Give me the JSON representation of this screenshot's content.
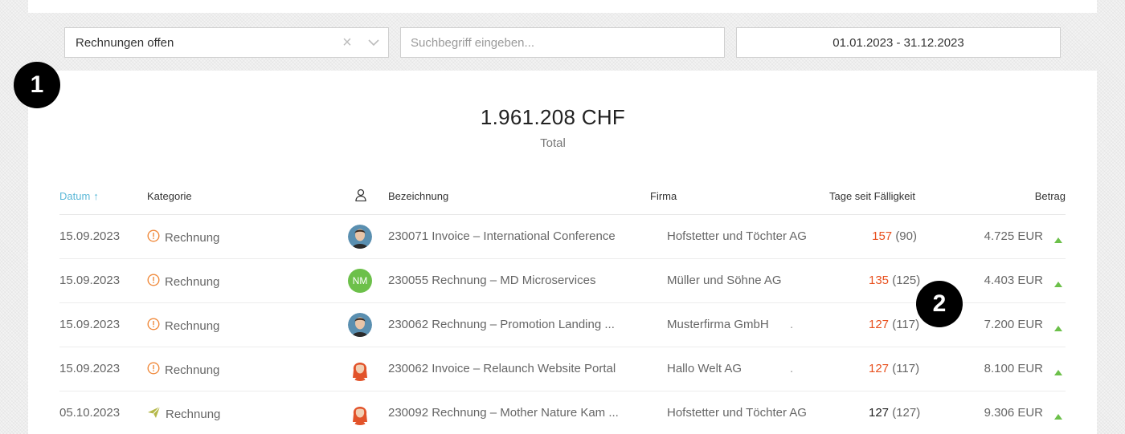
{
  "filters": {
    "status_value": "Rechnungen offen",
    "clear_glyph": "×",
    "search_placeholder": "Suchbegriff eingeben...",
    "date_range": "01.01.2023 - 31.12.2023"
  },
  "badges": {
    "one": "1",
    "two": "2"
  },
  "summary": {
    "amount": "1.961.208 CHF",
    "label": "Total"
  },
  "colors": {
    "accent": "#5bb8d8",
    "overdue": "#e8501e",
    "arrow": "#6cc04a",
    "warning": "#f08a3c",
    "sent": "#b5b84a"
  },
  "table": {
    "headers": {
      "date": "Datum",
      "sort_glyph": "↑",
      "category": "Kategorie",
      "user_icon": "person-icon",
      "title": "Bezeichnung",
      "company": "Firma",
      "days": "Tage seit Fälligkeit",
      "amount": "Betrag"
    },
    "rows": [
      {
        "date": "15.09.2023",
        "status_icon": "warning-circle-icon",
        "category": "Rechnung",
        "avatar": "male-avatar",
        "initials": "",
        "title": "230071 Invoice – International Conference",
        "company": "Hofstetter und Töchter AG",
        "days_main": "157",
        "days_paren": "(90)",
        "overdue": true,
        "amount": "4.725 EUR",
        "dot": ""
      },
      {
        "date": "15.09.2023",
        "status_icon": "warning-circle-icon",
        "category": "Rechnung",
        "avatar": "initials-avatar",
        "initials": "NM",
        "title": "230055 Rechnung – MD Microservices",
        "company": "Müller und Söhne AG",
        "days_main": "135",
        "days_paren": "(125)",
        "overdue": true,
        "amount": "4.403 EUR",
        "dot": ""
      },
      {
        "date": "15.09.2023",
        "status_icon": "warning-circle-icon",
        "category": "Rechnung",
        "avatar": "male-avatar",
        "initials": "",
        "title": "230062 Rechnung – Promotion Landing ...",
        "company": "Musterfirma GmbH",
        "days_main": "127",
        "days_paren": "(117)",
        "overdue": true,
        "amount": "7.200 EUR",
        "dot": "."
      },
      {
        "date": "15.09.2023",
        "status_icon": "warning-circle-icon",
        "category": "Rechnung",
        "avatar": "female-avatar",
        "initials": "",
        "title": "230062 Invoice – Relaunch Website Portal",
        "company": "Hallo Welt AG",
        "days_main": "127",
        "days_paren": "(117)",
        "overdue": true,
        "amount": "8.100 EUR",
        "dot": "."
      },
      {
        "date": "05.10.2023",
        "status_icon": "paper-plane-icon",
        "category": "Rechnung",
        "avatar": "female-avatar",
        "initials": "",
        "title": "230092 Rechnung – Mother Nature Kam ...",
        "company": "Hofstetter und Töchter AG",
        "days_main": "127",
        "days_paren": "(127)",
        "overdue": false,
        "amount": "9.306 EUR",
        "dot": ""
      }
    ]
  }
}
